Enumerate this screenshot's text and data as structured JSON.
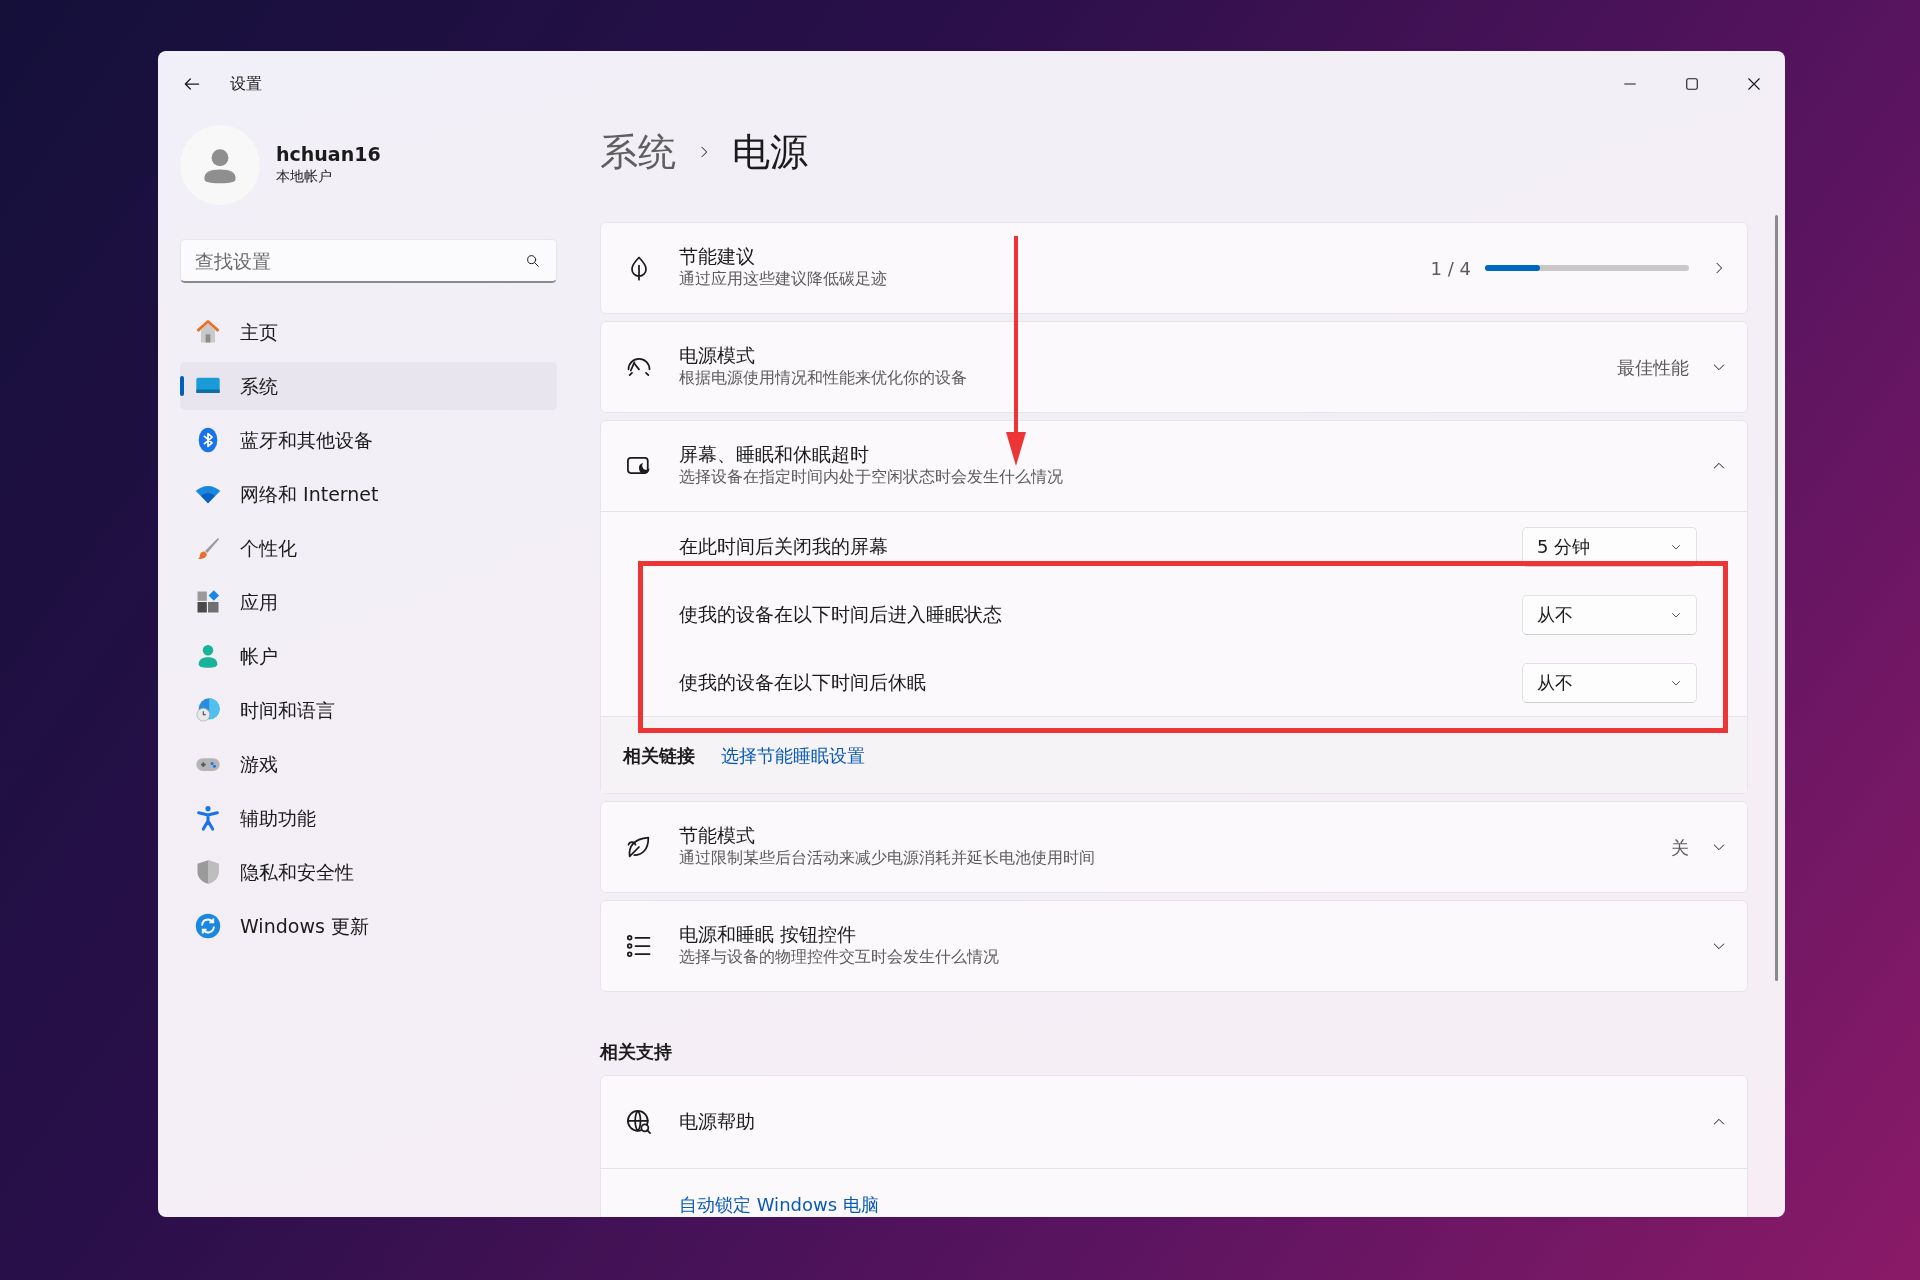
{
  "window": {
    "title": "设置"
  },
  "profile": {
    "name": "hchuan16",
    "account_type": "本地帐户"
  },
  "search": {
    "placeholder": "查找设置"
  },
  "sidebar": {
    "items": [
      {
        "label": "主页",
        "kind": "home",
        "selected": false
      },
      {
        "label": "系统",
        "kind": "system",
        "selected": true
      },
      {
        "label": "蓝牙和其他设备",
        "kind": "bluetooth",
        "selected": false
      },
      {
        "label": "网络和 Internet",
        "kind": "wifi",
        "selected": false
      },
      {
        "label": "个性化",
        "kind": "brush",
        "selected": false
      },
      {
        "label": "应用",
        "kind": "apps",
        "selected": false
      },
      {
        "label": "帐户",
        "kind": "person",
        "selected": false
      },
      {
        "label": "时间和语言",
        "kind": "globe-clock",
        "selected": false
      },
      {
        "label": "游戏",
        "kind": "gamepad",
        "selected": false
      },
      {
        "label": "辅助功能",
        "kind": "accessibility",
        "selected": false
      },
      {
        "label": "隐私和安全性",
        "kind": "shield",
        "selected": false
      },
      {
        "label": "Windows 更新",
        "kind": "update",
        "selected": false
      }
    ]
  },
  "breadcrumb": [
    "系统",
    "电源"
  ],
  "cards": [
    {
      "kind": "progress",
      "title": "节能建议",
      "subtitle": "通过应用这些建议降低碳足迹",
      "counter": "1 / 4",
      "level": 0.27
    },
    {
      "kind": "dropdown",
      "title": "电源模式",
      "subtitle": "根据电源使用情况和性能来优化你的设备",
      "value": "最佳性能",
      "expanded": false
    },
    {
      "kind": "expander",
      "title": "屏幕、睡眠和休眠超时",
      "subtitle": "选择设备在指定时间内处于空闲状态时会发生什么情况",
      "expanded": true,
      "settings": [
        {
          "label": "在此时间后关闭我的屏幕",
          "value": "5 分钟"
        },
        {
          "label": "使我的设备在以下时间后进入睡眠状态",
          "value": "从不"
        },
        {
          "label": "使我的设备在以下时间后休眠",
          "value": "从不"
        }
      ],
      "related": {
        "label": "相关链接",
        "link": "选择节能睡眠设置"
      }
    },
    {
      "kind": "dropdown",
      "title": "节能模式",
      "subtitle": "通过限制某些后台活动来减少电源消耗并延长电池使用时间",
      "value": "关",
      "expanded": false
    },
    {
      "kind": "expander",
      "title": "电源和睡眠 按钮控件",
      "subtitle": "选择与设备的物理控件交互时会发生什么情况",
      "expanded": false
    }
  ],
  "support": {
    "heading": "相关支持",
    "cards": [
      {
        "title": "电源帮助",
        "expanded": true,
        "links": [
          "自动锁定 Windows 电脑"
        ]
      }
    ]
  },
  "annotations": [
    {
      "kind": "arrow",
      "color": "#ee3535"
    },
    {
      "kind": "box",
      "color": "#ee3535"
    }
  ]
}
